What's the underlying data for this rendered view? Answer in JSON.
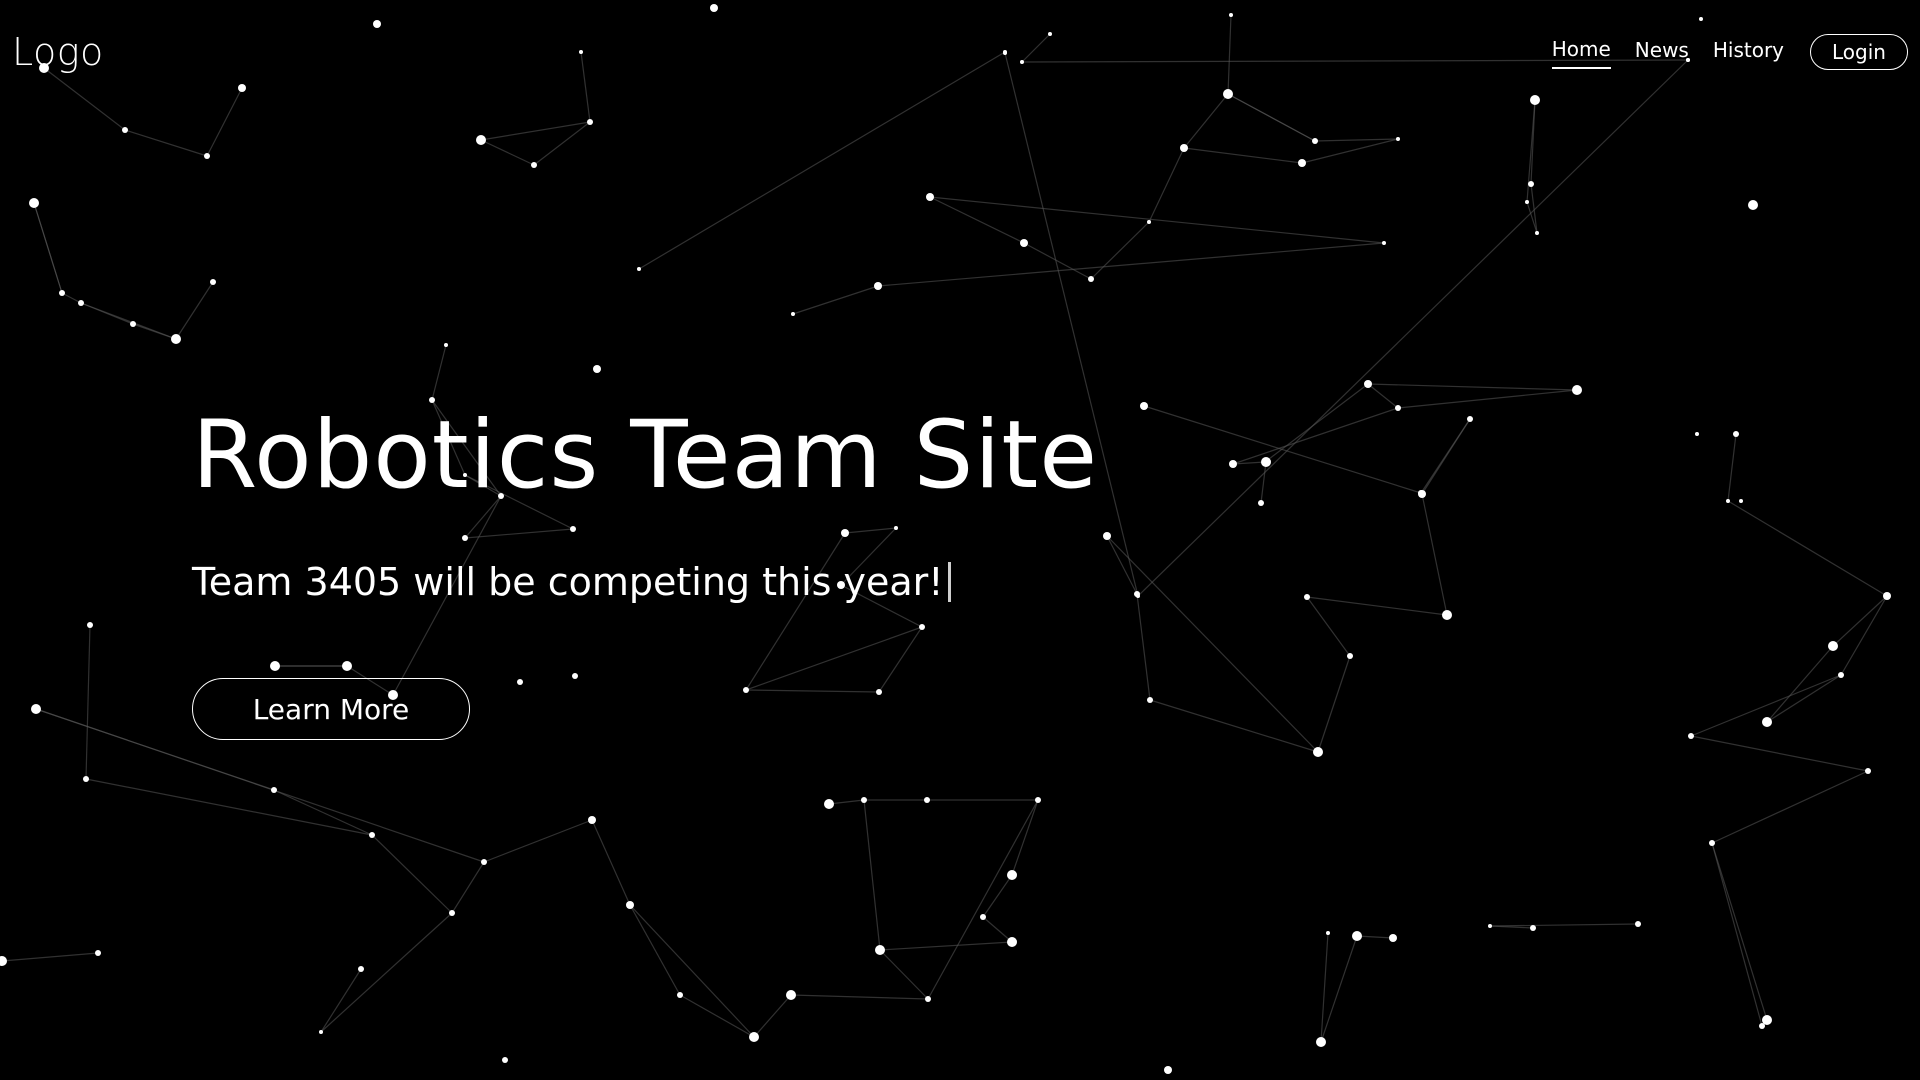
{
  "navbar": {
    "logo": "Logo",
    "links": [
      {
        "label": "Home",
        "active": true
      },
      {
        "label": "News",
        "active": false
      },
      {
        "label": "History",
        "active": false
      }
    ],
    "login_label": "Login"
  },
  "hero": {
    "title": "Robotics Team Site",
    "subtitle": "Team 3405 will be competing this year!",
    "cta_label": "Learn More"
  },
  "theme": {
    "background": "#000000",
    "foreground": "#ffffff",
    "link_line": "#5a5a5a",
    "caret": "#cfcfcf"
  }
}
